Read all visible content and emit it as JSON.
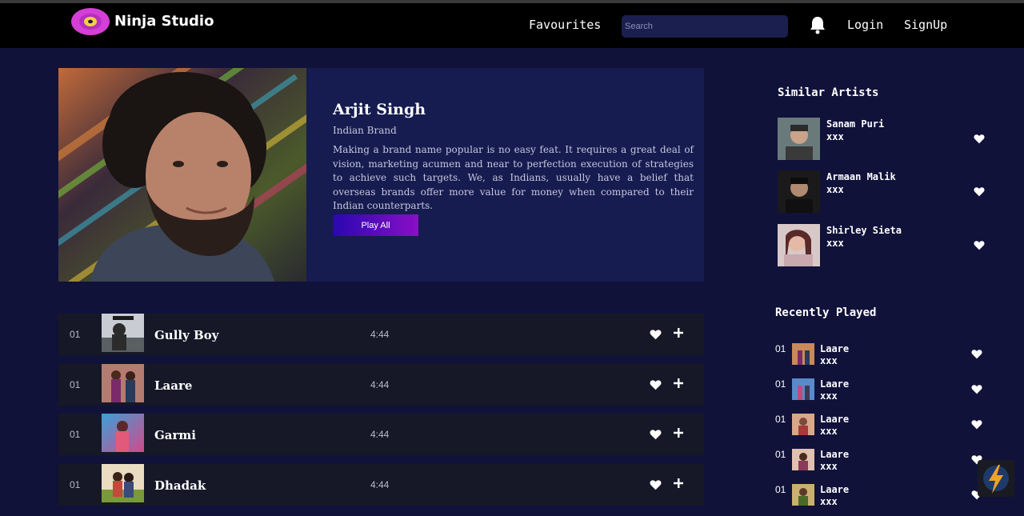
{
  "header": {
    "brand": "Ninja Studio",
    "nav_favourites": "Favourites",
    "search_placeholder": "Search",
    "login": "Login",
    "signup": "SignUp"
  },
  "hero": {
    "name": "Arjit Singh",
    "subtitle": "Indian Brand",
    "description": "Making a brand name popular is no easy feat. It requires a great deal of vision, marketing acumen and near to perfection execution of strategies to achieve such targets. We, as Indians, usually have a belief that overseas brands offer more value for money when compared to their Indian counterparts.",
    "play_label": "Play All"
  },
  "songs": [
    {
      "num": "01",
      "title": "Gully Boy",
      "duration": "4:44"
    },
    {
      "num": "01",
      "title": "Laare",
      "duration": "4:44"
    },
    {
      "num": "01",
      "title": "Garmi",
      "duration": "4:44"
    },
    {
      "num": "01",
      "title": "Dhadak",
      "duration": "4:44"
    }
  ],
  "similar_artists": {
    "title": "Similar Artists",
    "items": [
      {
        "name": "Sanam Puri",
        "sub": "xxx"
      },
      {
        "name": "Armaan Malik",
        "sub": "xxx"
      },
      {
        "name": "Shirley Sieta",
        "sub": "xxx"
      }
    ]
  },
  "recently_played": {
    "title": "Recently Played",
    "items": [
      {
        "num": "01",
        "title": "Laare",
        "sub": "xxx"
      },
      {
        "num": "01",
        "title": "Laare",
        "sub": "xxx"
      },
      {
        "num": "01",
        "title": "Laare",
        "sub": "xxx"
      },
      {
        "num": "01",
        "title": "Laare",
        "sub": "xxx"
      },
      {
        "num": "01",
        "title": "Laare",
        "sub": "xxx"
      }
    ]
  },
  "colors": {
    "background": "#10123a",
    "navbar": "#000000",
    "hero_panel": "#161b50",
    "song_row": "#161827",
    "accent_start": "#2a07b0",
    "accent_end": "#8a0fc6",
    "logo_pink": "#d43fd6",
    "logo_yellow": "#f2d23a"
  },
  "icons": [
    "vinyl-logo-icon",
    "bell-icon",
    "heart-icon",
    "plus-icon",
    "lightning-icon"
  ]
}
